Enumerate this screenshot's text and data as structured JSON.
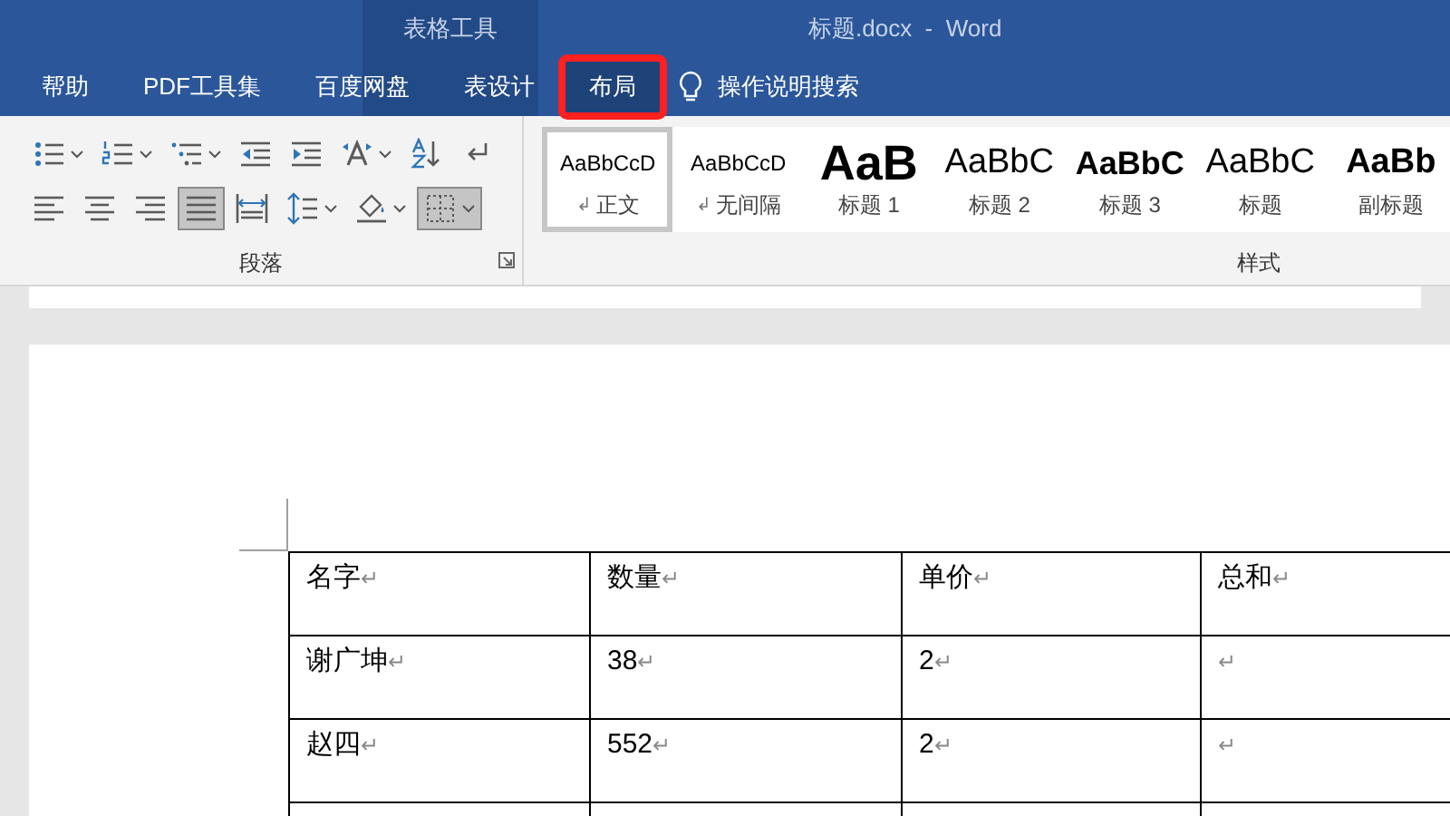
{
  "window": {
    "context_tab_group": "表格工具",
    "title": "标题.docx  -  Word"
  },
  "tabs": [
    {
      "label": "帮助",
      "selected": false,
      "contextual": false,
      "highlighted": false
    },
    {
      "label": "PDF工具集",
      "selected": false,
      "contextual": false,
      "highlighted": false
    },
    {
      "label": "百度网盘",
      "selected": false,
      "contextual": false,
      "highlighted": false
    },
    {
      "label": "表设计",
      "selected": false,
      "contextual": true,
      "highlighted": false
    },
    {
      "label": "布局",
      "selected": true,
      "contextual": true,
      "highlighted": true
    }
  ],
  "tell_me": {
    "label": "操作说明搜索"
  },
  "paragraph_group": {
    "label": "段落",
    "row_1": [
      {
        "kind": "bullets",
        "dropdown": true,
        "selected": false
      },
      {
        "kind": "numbering",
        "dropdown": true,
        "selected": false
      },
      {
        "kind": "multilevel",
        "dropdown": true,
        "selected": false
      },
      {
        "kind": "outdent",
        "dropdown": false,
        "selected": false
      },
      {
        "kind": "indent",
        "dropdown": false,
        "selected": false
      },
      {
        "kind": "direction",
        "dropdown": true,
        "selected": false
      },
      {
        "kind": "sort",
        "dropdown": false,
        "selected": false
      },
      {
        "kind": "marks",
        "dropdown": false,
        "selected": false
      }
    ],
    "row_2": [
      {
        "kind": "left",
        "dropdown": false,
        "selected": false
      },
      {
        "kind": "center",
        "dropdown": false,
        "selected": false
      },
      {
        "kind": "right",
        "dropdown": false,
        "selected": false
      },
      {
        "kind": "justify",
        "dropdown": false,
        "selected": true
      },
      {
        "kind": "distribute",
        "dropdown": false,
        "selected": false
      },
      {
        "kind": "spacing",
        "dropdown": true,
        "selected": false
      },
      {
        "kind": "shading",
        "dropdown": true,
        "selected": false
      },
      {
        "kind": "borders",
        "dropdown": true,
        "selected": true
      }
    ]
  },
  "styles_group": {
    "label": "样式",
    "items": [
      {
        "preview": "AaBbCcD",
        "name": "正文",
        "mark": "↲",
        "kind": "normal",
        "selected": true
      },
      {
        "preview": "AaBbCcD",
        "name": "无间隔",
        "mark": "↲",
        "kind": "normal",
        "selected": false
      },
      {
        "preview": "AaB",
        "name": "标题 1",
        "kind": "heading1",
        "selected": false
      },
      {
        "preview": "AaBbC",
        "name": "标题 2",
        "kind": "heading2",
        "selected": false
      },
      {
        "preview": "AaBbC",
        "name": "标题 3",
        "kind": "heading3",
        "selected": false
      },
      {
        "preview": "AaBbC",
        "name": "标题",
        "kind": "title",
        "selected": false
      },
      {
        "preview": "AaBb",
        "name": "副标题",
        "kind": "subtitle",
        "selected": false
      }
    ]
  },
  "table": {
    "rows": [
      [
        {
          "text": "名字",
          "mark": "↵"
        },
        {
          "text": "数量",
          "mark": "↵"
        },
        {
          "text": "单价",
          "mark": "↵"
        },
        {
          "text": "总和",
          "mark": "↵"
        }
      ],
      [
        {
          "text": "谢广坤",
          "mark": "↵"
        },
        {
          "text": "38",
          "mark": "↵"
        },
        {
          "text": "2",
          "mark": "↵"
        },
        {
          "mark": "↵"
        }
      ],
      [
        {
          "text": "赵四",
          "mark": "↵"
        },
        {
          "text": "552",
          "mark": "↵"
        },
        {
          "text": "2",
          "mark": "↵"
        },
        {
          "mark": "↵"
        }
      ]
    ]
  }
}
